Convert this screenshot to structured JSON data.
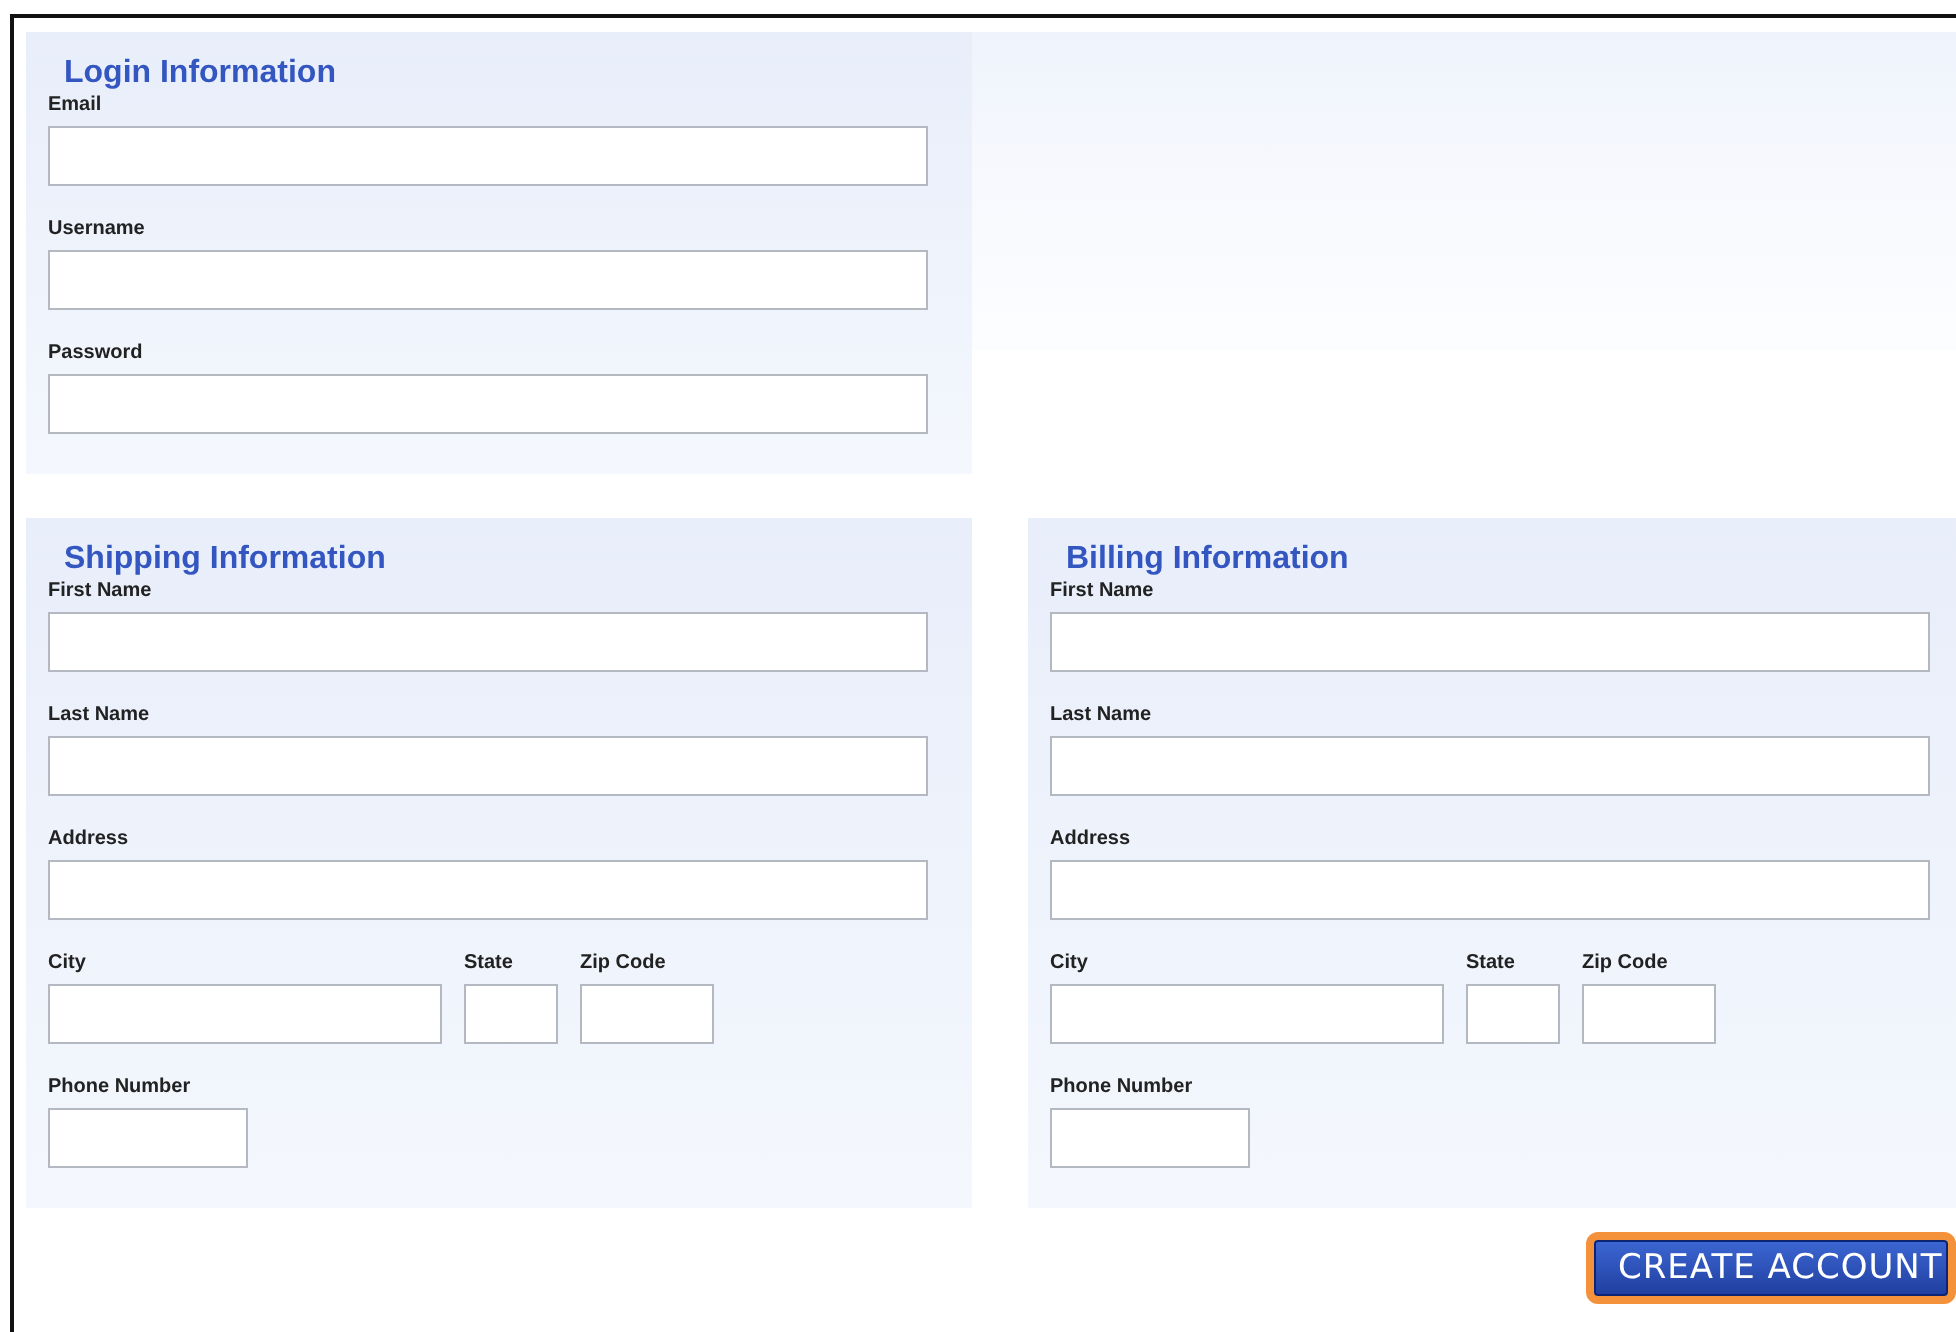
{
  "sections": [
    {
      "title": "Login Information",
      "rows": [
        [
          {
            "label": "Email",
            "kind": "wide"
          }
        ],
        [
          {
            "label": "Username",
            "kind": "wide"
          }
        ],
        [
          {
            "label": "Password",
            "kind": "wide"
          }
        ]
      ]
    },
    {
      "title": "Shipping Information",
      "rows": [
        [
          {
            "label": "First Name",
            "kind": "wide"
          }
        ],
        [
          {
            "label": "Last Name",
            "kind": "wide"
          }
        ],
        [
          {
            "label": "Address",
            "kind": "wide"
          }
        ],
        [
          {
            "label": "City",
            "kind": "city"
          },
          {
            "label": "State",
            "kind": "state"
          },
          {
            "label": "Zip Code",
            "kind": "zip"
          }
        ],
        [
          {
            "label": "Phone Number",
            "kind": "phone"
          }
        ]
      ]
    },
    {
      "title": "Billing Information",
      "rows": [
        [
          {
            "label": "First Name",
            "kind": "wide"
          }
        ],
        [
          {
            "label": "Last Name",
            "kind": "wide"
          }
        ],
        [
          {
            "label": "Address",
            "kind": "wide"
          }
        ],
        [
          {
            "label": "City",
            "kind": "city"
          },
          {
            "label": "State",
            "kind": "state"
          },
          {
            "label": "Zip Code",
            "kind": "zip"
          }
        ],
        [
          {
            "label": "Phone Number",
            "kind": "phone"
          }
        ]
      ]
    }
  ],
  "button": "CREATE ACCOUNT"
}
